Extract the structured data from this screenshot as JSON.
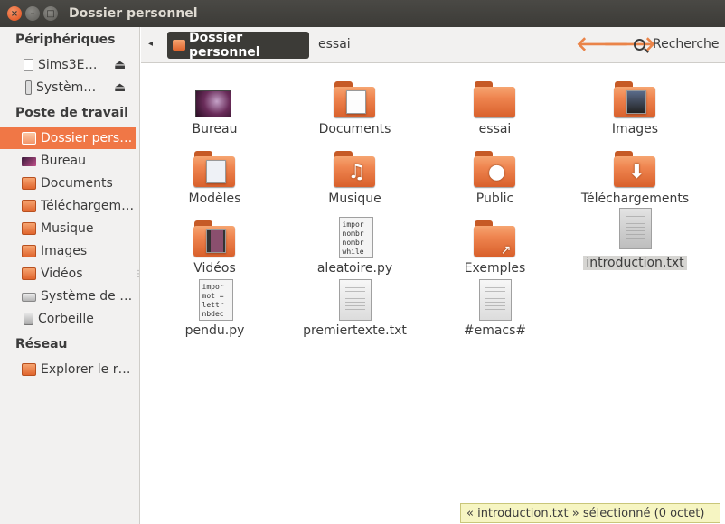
{
  "window": {
    "title": "Dossier personnel",
    "close_glyph": "×",
    "min_glyph": "–",
    "max_glyph": "□"
  },
  "sidebar": {
    "sections": [
      {
        "heading": "Périphériques",
        "items": [
          {
            "label": "Sims3E…",
            "icon": "drive-icon",
            "eject": "⏏"
          },
          {
            "label": "Systèm…",
            "icon": "usb-icon",
            "eject": "⏏"
          }
        ]
      },
      {
        "heading": "Poste de travail",
        "items": [
          {
            "label": "Dossier pers…",
            "icon": "home-folder-icon",
            "active": true
          },
          {
            "label": "Bureau",
            "icon": "desktop-icon"
          },
          {
            "label": "Documents",
            "icon": "documents-folder-icon"
          },
          {
            "label": "Téléchargem…",
            "icon": "downloads-folder-icon"
          },
          {
            "label": "Musique",
            "icon": "music-folder-icon"
          },
          {
            "label": "Images",
            "icon": "pictures-folder-icon"
          },
          {
            "label": "Vidéos",
            "icon": "videos-folder-icon"
          },
          {
            "label": "Système de …",
            "icon": "filesystem-icon"
          },
          {
            "label": "Corbeille",
            "icon": "trash-icon"
          }
        ]
      },
      {
        "heading": "Réseau",
        "items": [
          {
            "label": "Explorer le r…",
            "icon": "network-icon"
          }
        ]
      }
    ]
  },
  "toolbar": {
    "back_small": "◂",
    "breadcrumb_active": "Dossier personnel",
    "breadcrumb_next": "essai",
    "back_arrow": "🡐",
    "forward_arrow": "🡒",
    "search_label": "Recherche"
  },
  "files": [
    {
      "name": "Bureau",
      "type": "desktop"
    },
    {
      "name": "Documents",
      "type": "folder-docs"
    },
    {
      "name": "essai",
      "type": "folder"
    },
    {
      "name": "Images",
      "type": "folder-images"
    },
    {
      "name": "Modèles",
      "type": "folder-templates"
    },
    {
      "name": "Musique",
      "type": "folder-music"
    },
    {
      "name": "Public",
      "type": "folder-public"
    },
    {
      "name": "Téléchargements",
      "type": "folder-downloads"
    },
    {
      "name": "Vidéos",
      "type": "folder-videos"
    },
    {
      "name": "aleatoire.py",
      "type": "py",
      "preview": "impor\nnombr\nnombr\nwhile"
    },
    {
      "name": "Exemples",
      "type": "folder-link"
    },
    {
      "name": "introduction.txt",
      "type": "txt-grey",
      "selected": true
    },
    {
      "name": "pendu.py",
      "type": "py",
      "preview": "impor\nmot =\nlettr\nnbdec"
    },
    {
      "name": "premiertexte.txt",
      "type": "txt"
    },
    {
      "name": "#emacs#",
      "type": "txt"
    }
  ],
  "status": {
    "text": "« introduction.txt » sélectionné (0 octet)"
  },
  "colors": {
    "accent": "#f07746",
    "folder": "#e97a45",
    "titlebar": "#3c3b37"
  }
}
